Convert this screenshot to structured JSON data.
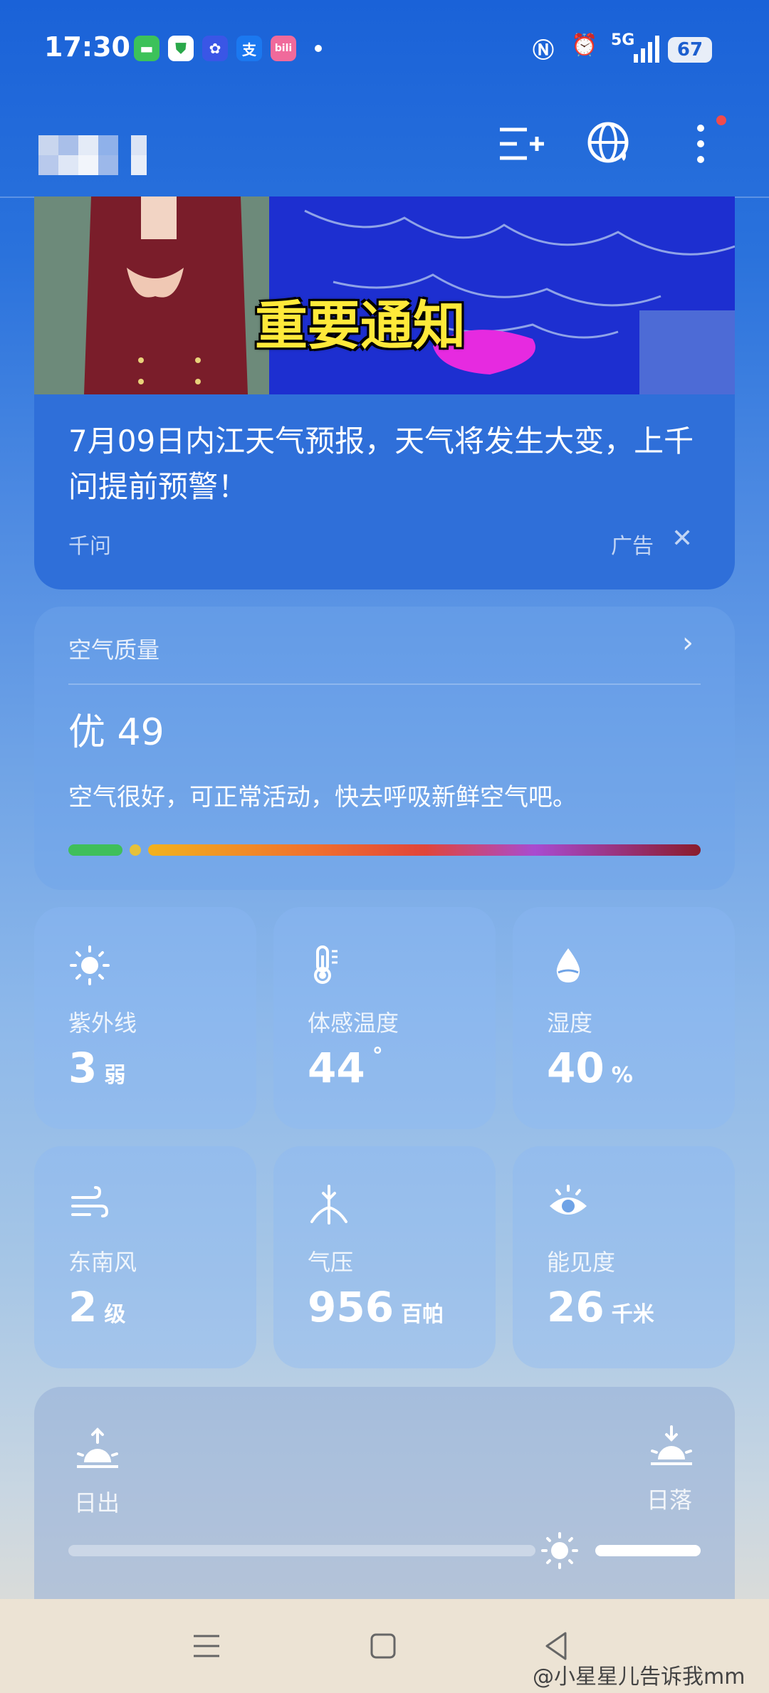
{
  "status_bar": {
    "time": "17:30",
    "network": "5G",
    "battery": "67",
    "notification_apps": [
      "messages-app-icon",
      "security-app-icon",
      "app-icon",
      "alipay-icon",
      "bilibili-icon"
    ]
  },
  "header": {
    "location_blurred": true,
    "icons": [
      "manage-cities-icon",
      "globe-icon",
      "more-menu-icon"
    ]
  },
  "ad": {
    "banner_text": "重要通知",
    "title": "7月09日内江天气预报，天气将发生大变，上千问提前预警！",
    "source": "千问",
    "label": "广告",
    "close": "✕"
  },
  "air_quality": {
    "title": "空气质量",
    "level": "优 49",
    "description": "空气很好，可正常活动，快去呼吸新鲜空气吧。",
    "value": 49,
    "scale_max": 500
  },
  "metrics": [
    {
      "icon": "sun-icon",
      "label": "紫外线",
      "value": "3",
      "unit": "弱"
    },
    {
      "icon": "thermometer-icon",
      "label": "体感温度",
      "value": "44",
      "unit": "°"
    },
    {
      "icon": "humidity-drop-icon",
      "label": "湿度",
      "value": "40",
      "unit": "%"
    },
    {
      "icon": "wind-icon",
      "label": "东南风",
      "value": "2",
      "unit": "级"
    },
    {
      "icon": "pressure-icon",
      "label": "气压",
      "value": "956",
      "unit": "百帕"
    },
    {
      "icon": "eye-icon",
      "label": "能见度",
      "value": "26",
      "unit": "千米"
    }
  ],
  "sun": {
    "sunrise_label": "日出",
    "sunset_label": "日落",
    "progress": 0.88
  },
  "watermark": "@小星星儿告诉我mm",
  "colors": {
    "accent": "#1a62d8",
    "aq_bar": [
      "#3fbf5a",
      "#e6c13a",
      "#f29a2e",
      "#e54a3c",
      "#a84bd0",
      "#8a1c2c"
    ]
  }
}
